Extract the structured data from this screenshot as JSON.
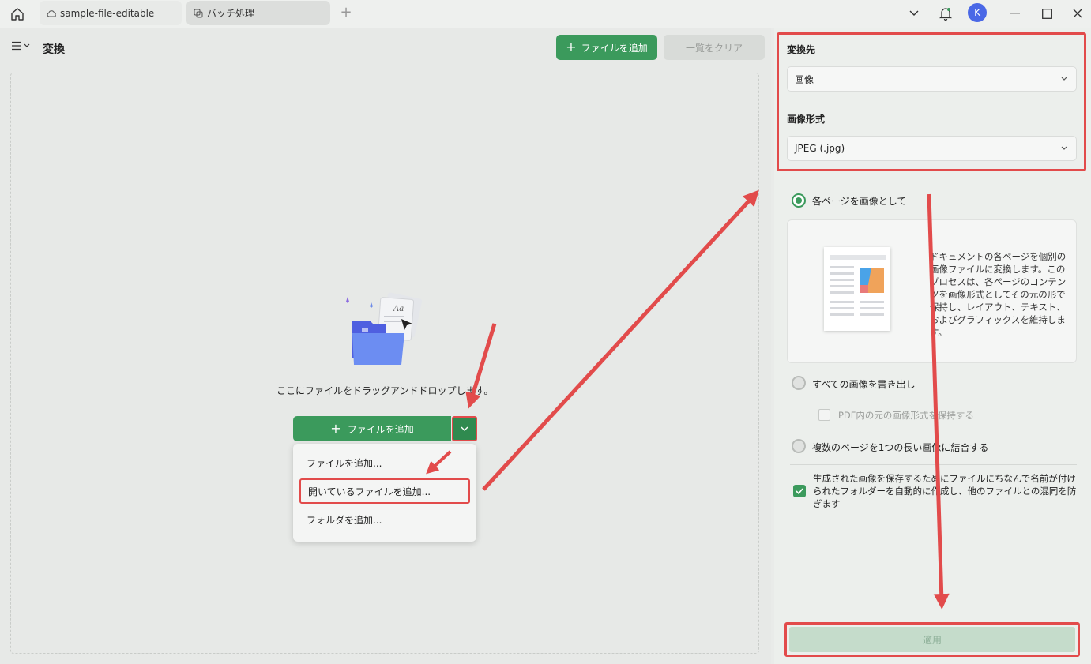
{
  "titlebar": {
    "tabs": [
      {
        "label": "sample-file-editable",
        "icon": "cloud-icon"
      },
      {
        "label": "バッチ処理",
        "icon": "batch-icon"
      }
    ],
    "avatar_initial": "K"
  },
  "left": {
    "title": "変換",
    "add_file_button": "ファイルを追加",
    "clear_button": "一覧をクリア",
    "drop_text": "ここにファイルをドラッグアンドドロップします。",
    "main_add_button": "ファイルを追加",
    "dropdown": {
      "items": [
        "ファイルを追加...",
        "開いているファイルを追加...",
        "フォルダを追加..."
      ]
    }
  },
  "right": {
    "target_label": "変換先",
    "target_value": "画像",
    "format_label": "画像形式",
    "format_value": "JPEG (.jpg)",
    "options": [
      {
        "label": "各ページを画像として",
        "selected": true
      },
      {
        "label": "すべての画像を書き出し",
        "selected": false
      },
      {
        "label": "複数のページを1つの長い画像に結合する",
        "selected": false
      }
    ],
    "preview_description": "ドキュメントの各ページを個別の画像ファイルに変換します。このプロセスは、各ページのコンテンツを画像形式としてその元の形で保持し、レイアウト、テキスト、およびグラフィックスを維持します。",
    "keep_format_label": "PDF内の元の画像形式を保持する",
    "folder_option_label": "生成された画像を保存するためにファイルにちなんで名前が付けられたフォルダーを自動的に作成し、他のファイルとの混同を防ぎます",
    "apply_button": "適用"
  },
  "colors": {
    "accent": "#3b9a5c",
    "highlight": "#e24b4b",
    "avatar": "#4a68e6"
  }
}
